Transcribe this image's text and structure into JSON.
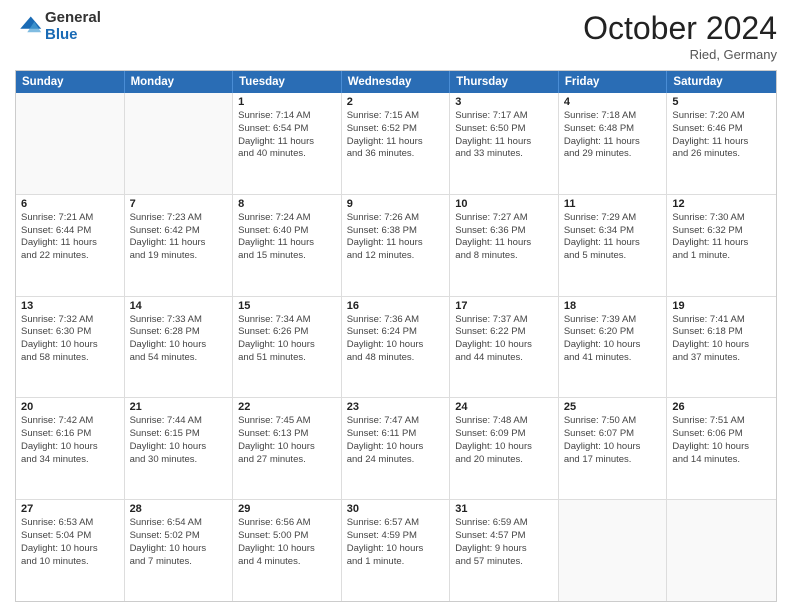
{
  "header": {
    "logo_general": "General",
    "logo_blue": "Blue",
    "month_title": "October 2024",
    "subtitle": "Ried, Germany"
  },
  "days_of_week": [
    "Sunday",
    "Monday",
    "Tuesday",
    "Wednesday",
    "Thursday",
    "Friday",
    "Saturday"
  ],
  "weeks": [
    [
      {
        "day": "",
        "lines": []
      },
      {
        "day": "",
        "lines": []
      },
      {
        "day": "1",
        "lines": [
          "Sunrise: 7:14 AM",
          "Sunset: 6:54 PM",
          "Daylight: 11 hours",
          "and 40 minutes."
        ]
      },
      {
        "day": "2",
        "lines": [
          "Sunrise: 7:15 AM",
          "Sunset: 6:52 PM",
          "Daylight: 11 hours",
          "and 36 minutes."
        ]
      },
      {
        "day": "3",
        "lines": [
          "Sunrise: 7:17 AM",
          "Sunset: 6:50 PM",
          "Daylight: 11 hours",
          "and 33 minutes."
        ]
      },
      {
        "day": "4",
        "lines": [
          "Sunrise: 7:18 AM",
          "Sunset: 6:48 PM",
          "Daylight: 11 hours",
          "and 29 minutes."
        ]
      },
      {
        "day": "5",
        "lines": [
          "Sunrise: 7:20 AM",
          "Sunset: 6:46 PM",
          "Daylight: 11 hours",
          "and 26 minutes."
        ]
      }
    ],
    [
      {
        "day": "6",
        "lines": [
          "Sunrise: 7:21 AM",
          "Sunset: 6:44 PM",
          "Daylight: 11 hours",
          "and 22 minutes."
        ]
      },
      {
        "day": "7",
        "lines": [
          "Sunrise: 7:23 AM",
          "Sunset: 6:42 PM",
          "Daylight: 11 hours",
          "and 19 minutes."
        ]
      },
      {
        "day": "8",
        "lines": [
          "Sunrise: 7:24 AM",
          "Sunset: 6:40 PM",
          "Daylight: 11 hours",
          "and 15 minutes."
        ]
      },
      {
        "day": "9",
        "lines": [
          "Sunrise: 7:26 AM",
          "Sunset: 6:38 PM",
          "Daylight: 11 hours",
          "and 12 minutes."
        ]
      },
      {
        "day": "10",
        "lines": [
          "Sunrise: 7:27 AM",
          "Sunset: 6:36 PM",
          "Daylight: 11 hours",
          "and 8 minutes."
        ]
      },
      {
        "day": "11",
        "lines": [
          "Sunrise: 7:29 AM",
          "Sunset: 6:34 PM",
          "Daylight: 11 hours",
          "and 5 minutes."
        ]
      },
      {
        "day": "12",
        "lines": [
          "Sunrise: 7:30 AM",
          "Sunset: 6:32 PM",
          "Daylight: 11 hours",
          "and 1 minute."
        ]
      }
    ],
    [
      {
        "day": "13",
        "lines": [
          "Sunrise: 7:32 AM",
          "Sunset: 6:30 PM",
          "Daylight: 10 hours",
          "and 58 minutes."
        ]
      },
      {
        "day": "14",
        "lines": [
          "Sunrise: 7:33 AM",
          "Sunset: 6:28 PM",
          "Daylight: 10 hours",
          "and 54 minutes."
        ]
      },
      {
        "day": "15",
        "lines": [
          "Sunrise: 7:34 AM",
          "Sunset: 6:26 PM",
          "Daylight: 10 hours",
          "and 51 minutes."
        ]
      },
      {
        "day": "16",
        "lines": [
          "Sunrise: 7:36 AM",
          "Sunset: 6:24 PM",
          "Daylight: 10 hours",
          "and 48 minutes."
        ]
      },
      {
        "day": "17",
        "lines": [
          "Sunrise: 7:37 AM",
          "Sunset: 6:22 PM",
          "Daylight: 10 hours",
          "and 44 minutes."
        ]
      },
      {
        "day": "18",
        "lines": [
          "Sunrise: 7:39 AM",
          "Sunset: 6:20 PM",
          "Daylight: 10 hours",
          "and 41 minutes."
        ]
      },
      {
        "day": "19",
        "lines": [
          "Sunrise: 7:41 AM",
          "Sunset: 6:18 PM",
          "Daylight: 10 hours",
          "and 37 minutes."
        ]
      }
    ],
    [
      {
        "day": "20",
        "lines": [
          "Sunrise: 7:42 AM",
          "Sunset: 6:16 PM",
          "Daylight: 10 hours",
          "and 34 minutes."
        ]
      },
      {
        "day": "21",
        "lines": [
          "Sunrise: 7:44 AM",
          "Sunset: 6:15 PM",
          "Daylight: 10 hours",
          "and 30 minutes."
        ]
      },
      {
        "day": "22",
        "lines": [
          "Sunrise: 7:45 AM",
          "Sunset: 6:13 PM",
          "Daylight: 10 hours",
          "and 27 minutes."
        ]
      },
      {
        "day": "23",
        "lines": [
          "Sunrise: 7:47 AM",
          "Sunset: 6:11 PM",
          "Daylight: 10 hours",
          "and 24 minutes."
        ]
      },
      {
        "day": "24",
        "lines": [
          "Sunrise: 7:48 AM",
          "Sunset: 6:09 PM",
          "Daylight: 10 hours",
          "and 20 minutes."
        ]
      },
      {
        "day": "25",
        "lines": [
          "Sunrise: 7:50 AM",
          "Sunset: 6:07 PM",
          "Daylight: 10 hours",
          "and 17 minutes."
        ]
      },
      {
        "day": "26",
        "lines": [
          "Sunrise: 7:51 AM",
          "Sunset: 6:06 PM",
          "Daylight: 10 hours",
          "and 14 minutes."
        ]
      }
    ],
    [
      {
        "day": "27",
        "lines": [
          "Sunrise: 6:53 AM",
          "Sunset: 5:04 PM",
          "Daylight: 10 hours",
          "and 10 minutes."
        ]
      },
      {
        "day": "28",
        "lines": [
          "Sunrise: 6:54 AM",
          "Sunset: 5:02 PM",
          "Daylight: 10 hours",
          "and 7 minutes."
        ]
      },
      {
        "day": "29",
        "lines": [
          "Sunrise: 6:56 AM",
          "Sunset: 5:00 PM",
          "Daylight: 10 hours",
          "and 4 minutes."
        ]
      },
      {
        "day": "30",
        "lines": [
          "Sunrise: 6:57 AM",
          "Sunset: 4:59 PM",
          "Daylight: 10 hours",
          "and 1 minute."
        ]
      },
      {
        "day": "31",
        "lines": [
          "Sunrise: 6:59 AM",
          "Sunset: 4:57 PM",
          "Daylight: 9 hours",
          "and 57 minutes."
        ]
      },
      {
        "day": "",
        "lines": []
      },
      {
        "day": "",
        "lines": []
      }
    ]
  ]
}
